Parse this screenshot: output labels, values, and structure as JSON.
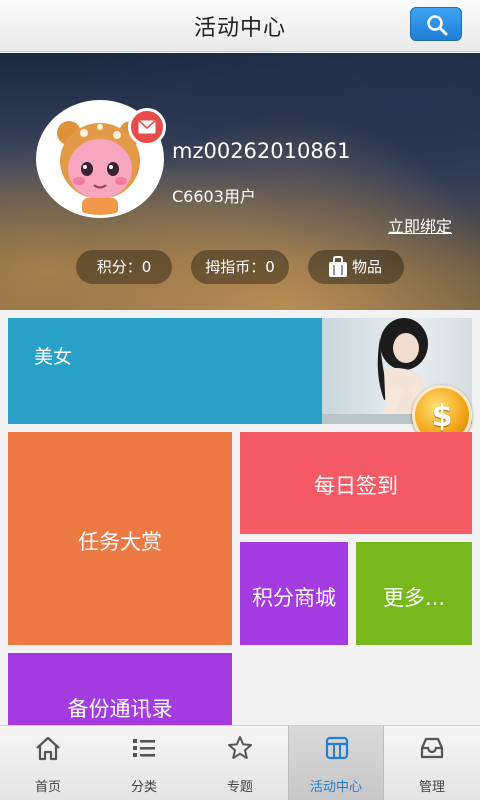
{
  "header": {
    "title": "活动中心",
    "search_icon": "search-icon"
  },
  "profile": {
    "username": "mz00262010861",
    "device": "C6603用户",
    "bind_link": "立即绑定",
    "points": "积分：0",
    "coins": "拇指币：0",
    "items": "物品",
    "items_icon": "bag-icon",
    "badge_icon": "mail-icon"
  },
  "tiles": {
    "beauty": "美女",
    "tasks": "任务大赏",
    "checkin": "每日签到",
    "mall": "积分商城",
    "more": "更多...",
    "backup": "备份通讯录"
  },
  "coin_button": {
    "symbol": "$",
    "icon": "coin-icon"
  },
  "colors": {
    "beauty": "#2aa0c8",
    "tasks": "#ec7844",
    "checkin": "#f45b67",
    "mall": "#a43be0",
    "more": "#78b81c",
    "backup": "#a43be0",
    "active_nav": "#1e7fd4"
  },
  "nav": {
    "items": [
      {
        "label": "首页",
        "icon": "home-icon"
      },
      {
        "label": "分类",
        "icon": "list-icon"
      },
      {
        "label": "专题",
        "icon": "star-icon"
      },
      {
        "label": "活动中心",
        "icon": "activity-icon",
        "active": true
      },
      {
        "label": "管理",
        "icon": "inbox-icon"
      }
    ]
  }
}
